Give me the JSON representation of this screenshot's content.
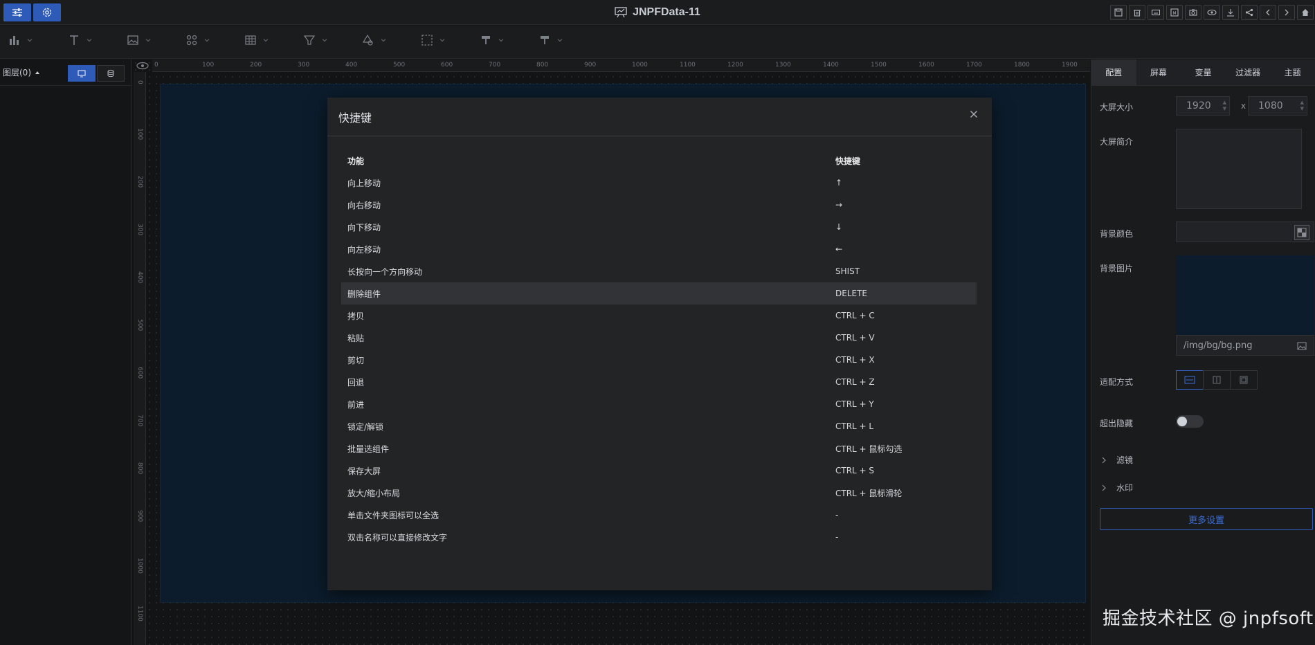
{
  "app": {
    "title": "JNPFData-11"
  },
  "left_panel": {
    "layers_label": "图层(0)"
  },
  "modal": {
    "title": "快捷键",
    "headers": {
      "function": "功能",
      "shortcut": "快捷键"
    },
    "rows": [
      {
        "function": "向上移动",
        "shortcut": "↑"
      },
      {
        "function": "向右移动",
        "shortcut": "→"
      },
      {
        "function": "向下移动",
        "shortcut": "↓"
      },
      {
        "function": "向左移动",
        "shortcut": "←"
      },
      {
        "function": "长按向一个方向移动",
        "shortcut": "SHIST"
      },
      {
        "function": "删除组件",
        "shortcut": "DELETE"
      },
      {
        "function": "拷贝",
        "shortcut": "CTRL + C"
      },
      {
        "function": "粘贴",
        "shortcut": "CTRL + V"
      },
      {
        "function": "剪切",
        "shortcut": "CTRL + X"
      },
      {
        "function": "回退",
        "shortcut": "CTRL + Z"
      },
      {
        "function": "前进",
        "shortcut": "CTRL + Y"
      },
      {
        "function": "锁定/解锁",
        "shortcut": "CTRL + L"
      },
      {
        "function": "批量选组件",
        "shortcut": "CTRL + 鼠标勾选"
      },
      {
        "function": "保存大屏",
        "shortcut": "CTRL + S"
      },
      {
        "function": "放大/缩小布局",
        "shortcut": "CTRL + 鼠标滑轮"
      },
      {
        "function": "单击文件夹图标可以全选",
        "shortcut": "-"
      },
      {
        "function": "双击名称可以直接修改文字",
        "shortcut": "-"
      }
    ]
  },
  "right_panel": {
    "tabs": [
      "配置",
      "屏幕",
      "变量",
      "过滤器",
      "主题"
    ],
    "screen_size_label": "大屏大小",
    "width_value": "1920",
    "height_value": "1080",
    "size_separator": "x",
    "intro_label": "大屏简介",
    "bg_color_label": "背景颜色",
    "bg_image_label": "背景图片",
    "bg_image_path": "/img/bg/bg.png",
    "fit_label": "适配方式",
    "overflow_label": "超出隐藏",
    "filter_label": "滤镜",
    "watermark_label": "水印",
    "more_settings": "更多设置"
  },
  "ruler": {
    "top_ticks": [
      "0",
      "100",
      "200",
      "300",
      "400",
      "500",
      "600",
      "700",
      "800",
      "900",
      "1000",
      "1100",
      "1200",
      "1300",
      "1400",
      "1500",
      "1600",
      "1700",
      "1800",
      "1900"
    ],
    "left_ticks": [
      "0",
      "100",
      "200",
      "300",
      "400",
      "500",
      "600",
      "700",
      "800",
      "900",
      "1000",
      "1100"
    ]
  },
  "watermark_text": "掘金技术社区 @ jnpfsoft",
  "colors": {
    "accent": "#2e5ab8",
    "stage": "#0c1c2c",
    "modal": "#232426"
  }
}
